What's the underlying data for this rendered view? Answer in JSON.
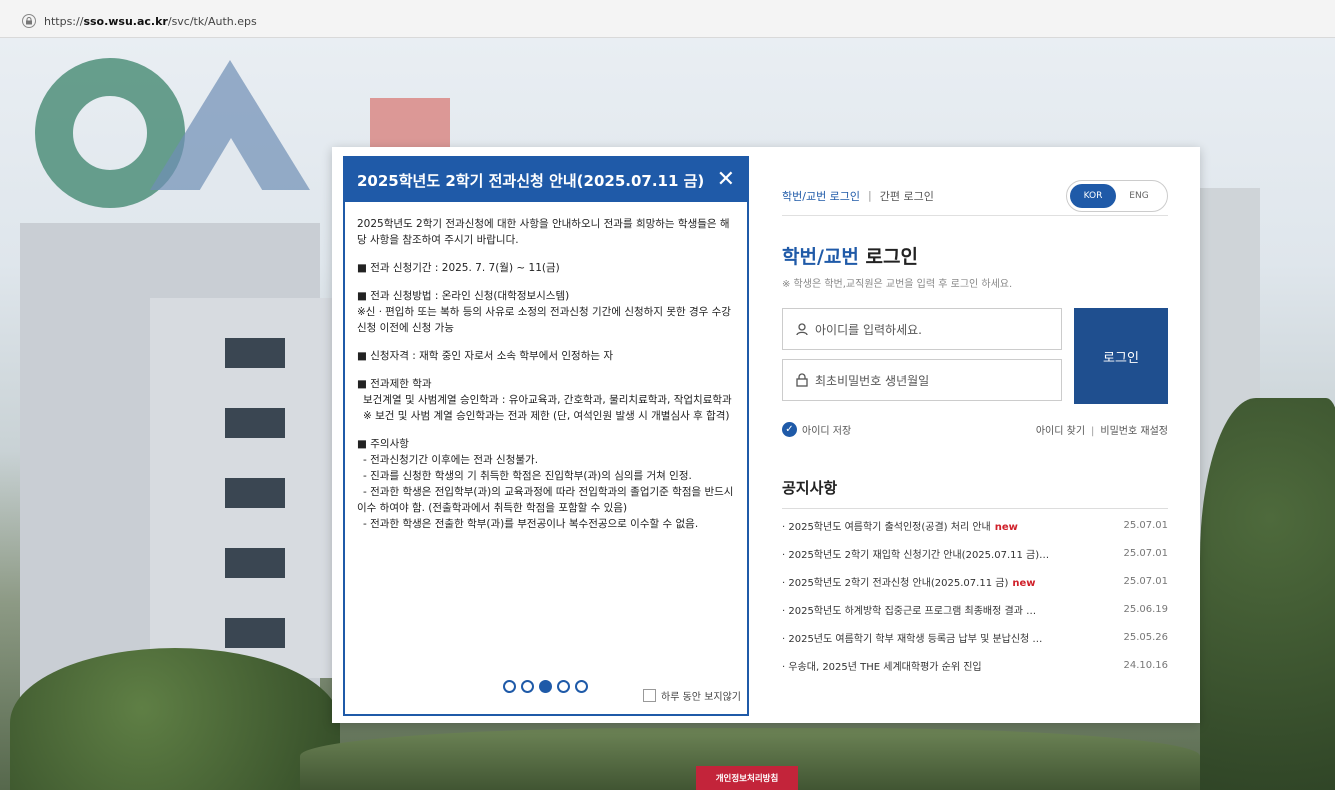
{
  "browser": {
    "url_prefix": "https://",
    "url_host": "sso.wsu.ac.kr",
    "url_path": "/svc/tk/Auth.eps"
  },
  "popup": {
    "title": "2025학년도 2학기 전과신청 안내(2025.07.11 금)",
    "close": "✕",
    "intro": "2025학년도 2학기 전과신청에 대한 사항을 안내하오니 전과를 희망하는 학생들은 해당 사항을 참조하여 주시기 바랍니다.",
    "period": "■ 전과 신청기간 : 2025. 7. 7(월) ~ 11(금)",
    "method": "■ 전과 신청방법 : 온라인 신청(대학정보시스템)",
    "method_note": "※신ㆍ편입하 또는 복하 등의 사유로 소정의 전과신청 기간에 신청하지 못한 경우 수강신청 이전에 신청 가능",
    "qualification": "■ 신청자격 : 재학 중인 자로서 소속 학부에서 인정하는 자",
    "restrict_title": "■ 전과제한 학과",
    "restrict_detail": "보건계열 및 사범계열 승인학과 : 유아교육과, 간호학과, 물리치료학과, 작업치료학과",
    "restrict_note": "※ 보건 및 사범 계열 승인학과는 전과 제한 (단, 여석인원 발생 시 개별심사 후 합격)",
    "caution_title": "■ 주의사항",
    "caution_1": "- 전과신청기간 이후에는 전과 신청불가.",
    "caution_2": "- 진과를 신청한 학생의 기 취득한 학점은 진입학부(과)의 심의를 거쳐 인정.",
    "caution_3": "- 전과한 학생은 전입학부(과)의 교육과정에 따라 전입학과의 졸업기준 학점을 반드시 이수 하여야 함. (전출학과에서 취득한 학점을 포함할 수 있음)",
    "caution_4": "- 전과한 학생은 전출한 학부(과)를 부전공이나 복수전공으로 이수할 수 없음.",
    "dont_show": "하루 동안 보지않기"
  },
  "login": {
    "tab_id": "학번/교번 로그인",
    "tab_sep": "|",
    "tab_simple": "간편 로그인",
    "lang_kor": "KOR",
    "lang_eng": "ENG",
    "title_blue": "학번/교번",
    "title_rest": " 로그인",
    "hint": "※ 학생은 학번,교직원은 교번을 입력 후 로그인 하세요.",
    "id_placeholder": "아이디를 입력하세요.",
    "pw_placeholder": "최초비밀번호 생년월일",
    "button": "로그인",
    "save_id": "아이디 저장",
    "find_id": "아이디 찾기",
    "link_sep": "|",
    "reset_pw": "비밀번호 재설정"
  },
  "notices": {
    "title": "공지사항",
    "items": [
      {
        "text": "· 2025학년도 여름학기 출석인정(공결) 처리 안내",
        "badge": "new",
        "date": "25.07.01"
      },
      {
        "text": "· 2025학년도 2학기 재입학 신청기간 안내(2025.07.11 금)…",
        "badge": "",
        "date": "25.07.01"
      },
      {
        "text": "· 2025학년도 2학기 전과신청 안내(2025.07.11 금)",
        "badge": "new",
        "date": "25.07.01"
      },
      {
        "text": "· 2025학년도 하계방학 집중근로 프로그램 최종배정 결과 …",
        "badge": "",
        "date": "25.06.19"
      },
      {
        "text": "· 2025년도 여름학기 학부 재학생 등록금 납부 및 분납신청 …",
        "badge": "",
        "date": "25.05.26"
      },
      {
        "text": "· 우송대, 2025년 THE 세계대학평가 순위 진입",
        "badge": "",
        "date": "24.10.16"
      }
    ]
  },
  "footer": {
    "privacy": "개인정보처리방침"
  },
  "colors": {
    "primary": "#1f5aa8",
    "button": "#1f4f8f",
    "new": "#d0202a",
    "privacy": "#c3243a"
  }
}
